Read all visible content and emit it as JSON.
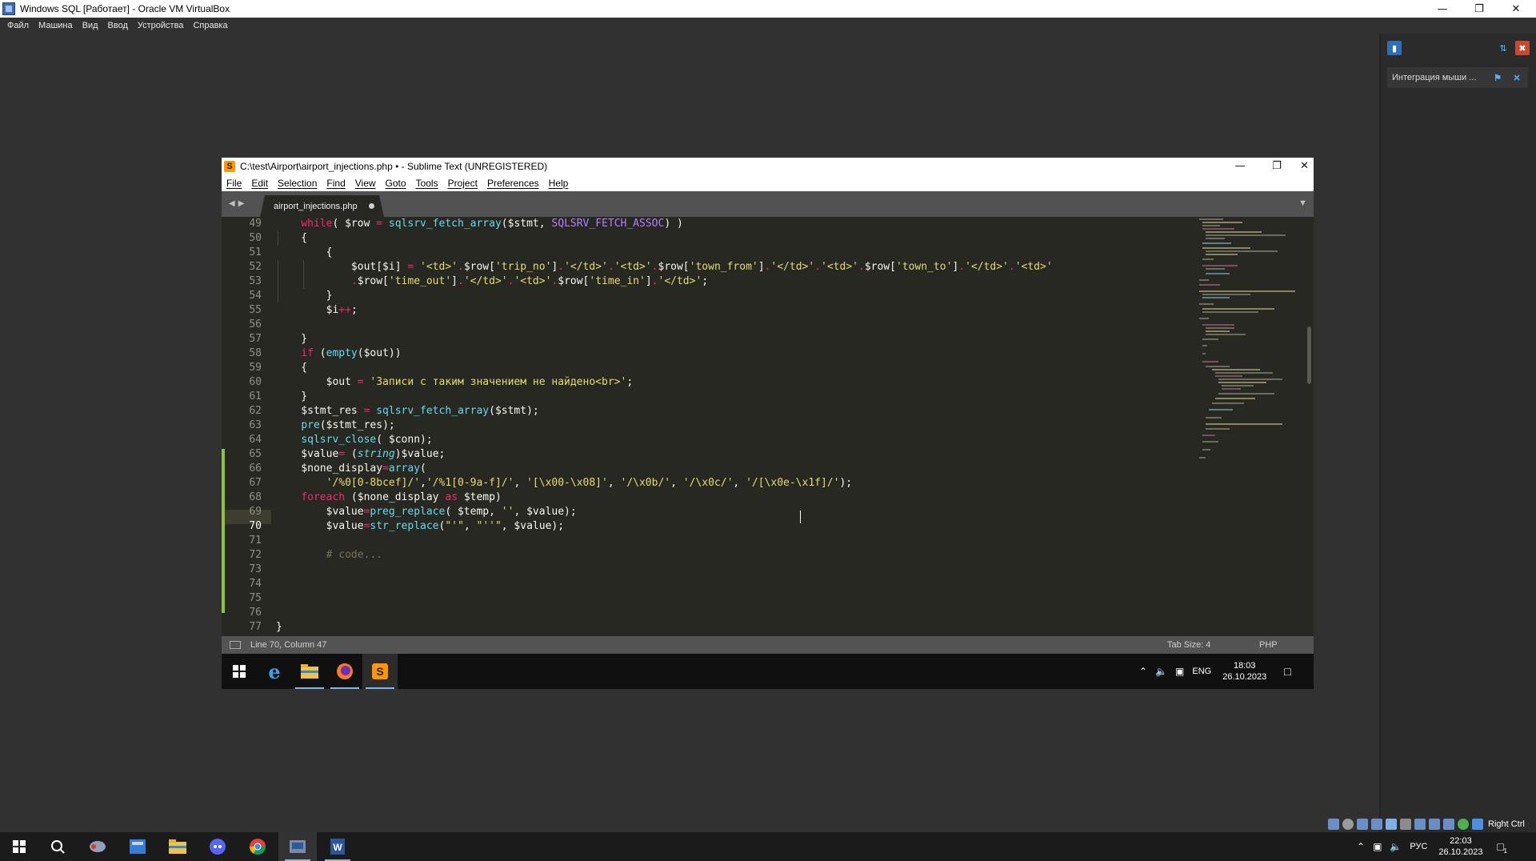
{
  "host": {
    "window_title": "Windows SQL [Работает] - Oracle VM VirtualBox",
    "menu": [
      "Файл",
      "Машина",
      "Вид",
      "Ввод",
      "Устройства",
      "Справка"
    ],
    "notification": "Интеграция мыши ...",
    "host_key": "Right Ctrl",
    "taskbar_tray": {
      "lang": "РУС",
      "time": "22:03",
      "date": "26.10.2023",
      "notif_count": "1"
    }
  },
  "sublime": {
    "window_title": "C:\\test\\Airport\\airport_injections.php • - Sublime Text (UNREGISTERED)",
    "menu": [
      "File",
      "Edit",
      "Selection",
      "Find",
      "View",
      "Goto",
      "Tools",
      "Project",
      "Preferences",
      "Help"
    ],
    "tab_label": "airport_injections.php",
    "status": {
      "position": "Line 70, Column 47",
      "tab_size": "Tab Size: 4",
      "syntax": "PHP"
    },
    "current_line": 70,
    "line_numbers": [
      "49",
      "50",
      "51",
      "52",
      "53",
      "54",
      "55",
      "56",
      "57",
      "58",
      "59",
      "60",
      "61",
      "62",
      "63",
      "64",
      "65",
      "66",
      "67",
      "68",
      "69",
      "70",
      "71",
      "72",
      "73",
      "74",
      "75",
      "76",
      "77"
    ]
  },
  "guest_taskbar": {
    "lang": "ENG",
    "time": "18:03",
    "date": "26.10.2023"
  },
  "colors": {
    "editor_bg": "#272822",
    "keyword": "#f92672",
    "function": "#66d9ef",
    "string": "#e6db74",
    "comment": "#75715e",
    "modified_gutter": "#8fc13d"
  },
  "icons": [
    "windows-start-icon",
    "search-icon",
    "internet-explorer-icon",
    "file-explorer-icon",
    "firefox-icon",
    "sublime-text-icon",
    "chrome-icon",
    "word-icon",
    "discord-icon"
  ]
}
